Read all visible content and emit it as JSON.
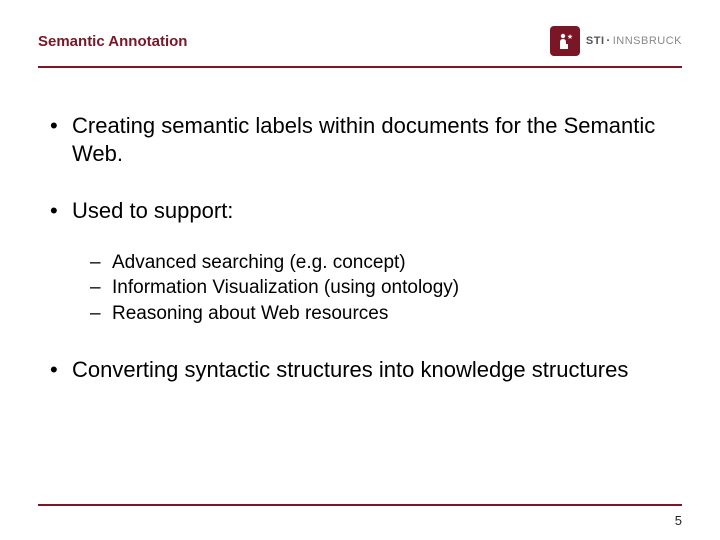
{
  "header": {
    "title": "Semantic Annotation",
    "logo": {
      "icon_name": "person-star-icon",
      "text_main": "STI",
      "text_sep": "·",
      "text_sub": "INNSBRUCK"
    }
  },
  "bullets": [
    {
      "text": "Creating semantic labels within documents for the Semantic Web.",
      "children": []
    },
    {
      "text": "Used to support:",
      "children": [
        "Advanced searching (e.g. concept)",
        "Information Visualization (using ontology)",
        "Reasoning about Web resources"
      ]
    },
    {
      "text": "Converting syntactic structures into knowledge structures",
      "children": []
    }
  ],
  "page_number": "5",
  "colors": {
    "accent": "#7a1626"
  }
}
